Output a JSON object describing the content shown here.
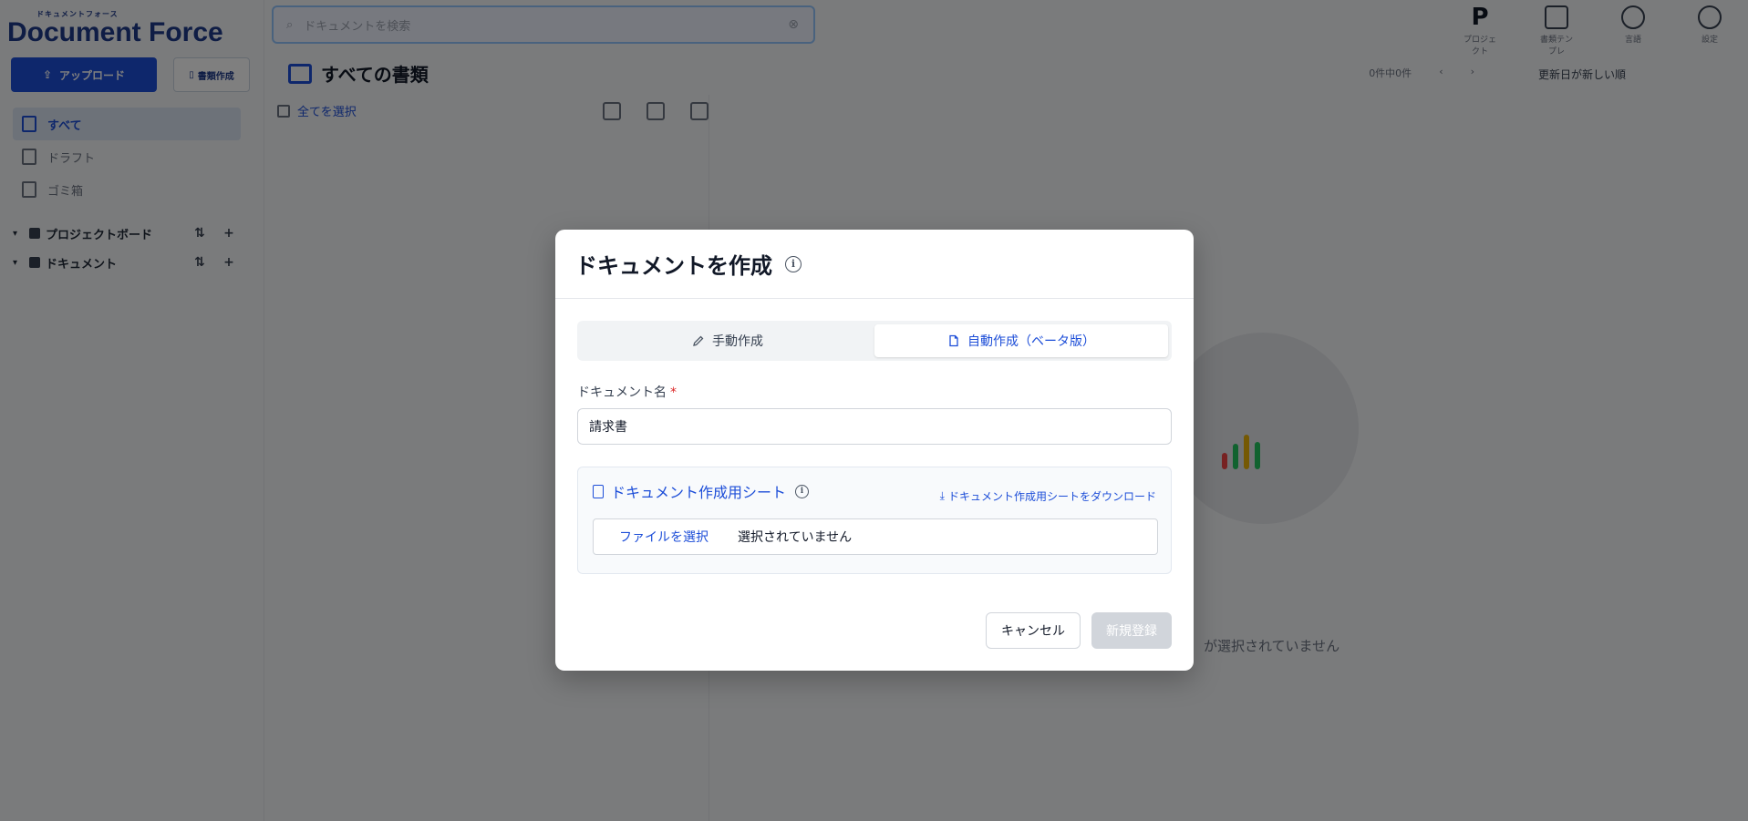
{
  "app": {
    "logo_small": "ドキュメントフォース",
    "logo_main": "Document Force",
    "upload_label": "アップロード",
    "new_doc_label": "書類作成",
    "search_placeholder": "ドキュメントを検索",
    "nav": [
      {
        "label": "すべて"
      },
      {
        "label": "ドラフト"
      },
      {
        "label": "ゴミ箱"
      }
    ],
    "tree": [
      {
        "label": "プロジェクトボード"
      },
      {
        "label": "ドキュメント"
      }
    ],
    "top_icons": [
      {
        "label": "プロジェクト"
      },
      {
        "label": "書類テンプレ"
      },
      {
        "label": "言語"
      },
      {
        "label": "設定"
      }
    ],
    "content_title": "すべての書類",
    "pager_text": "0件中0件",
    "sort_label": "更新日が新しい順",
    "select_all": "全てを選択",
    "empty_text": "が選択されていません"
  },
  "modal": {
    "title": "ドキュメントを作成",
    "tabs": [
      {
        "label": "手動作成",
        "icon": "pencil-icon",
        "active": false
      },
      {
        "label": "自動作成（ベータ版）",
        "icon": "document-icon",
        "active": true
      }
    ],
    "name_label": "ドキュメント名",
    "required_mark": "*",
    "name_value": "請求書",
    "sheet_title": "ドキュメント作成用シート",
    "download_label": "ドキュメント作成用シートをダウンロード",
    "file_button": "ファイルを選択",
    "file_status": "選択されていません",
    "cancel_label": "キャンセル",
    "submit_label": "新規登録"
  },
  "colors": {
    "accent": "#1d4ed8",
    "overlay": "#000000",
    "disabled": "#d1d5db",
    "required": "#dc2626"
  }
}
